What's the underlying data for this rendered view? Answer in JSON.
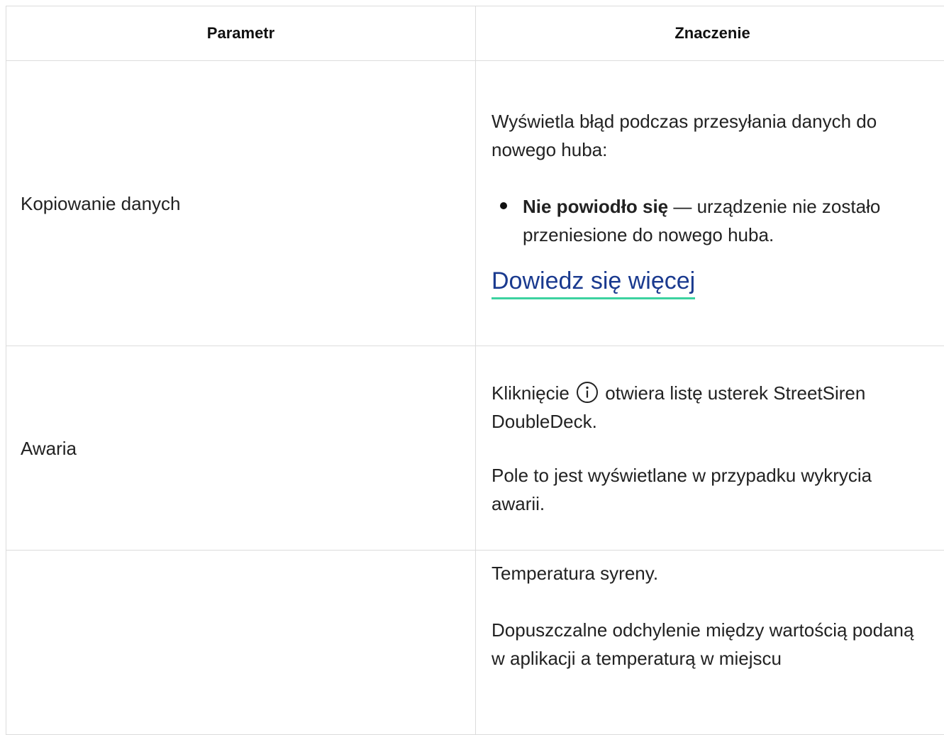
{
  "table": {
    "headers": [
      "Parametr",
      "Znaczenie"
    ],
    "rows": {
      "copy": {
        "param": "Kopiowanie danych",
        "intro": "Wyświetla błąd podczas przesyłania danych do nowego huba:",
        "bullet_bold": "Nie powiodło się",
        "bullet_text": " — urządzenie nie zostało przeniesione do nowego huba.",
        "link": "Dowiedz się więcej"
      },
      "fault": {
        "param": "Awaria",
        "line1_before": "Kliknięcie ",
        "icon": "info-icon",
        "line1_after": " otwiera listę usterek StreetSiren DoubleDeck.",
        "line2": "Pole to jest wyświetlane w przypadku wykrycia awarii."
      },
      "temp": {
        "param": "",
        "line1": "Temperatura syreny.",
        "line2": "Dopuszczalne odchylenie między wartością podaną w aplikacji a temperaturą w miejscu"
      }
    }
  },
  "colors": {
    "border": "#dcdcdc",
    "link": "#1a3a8f",
    "link_underline": "#3cd2a0"
  }
}
